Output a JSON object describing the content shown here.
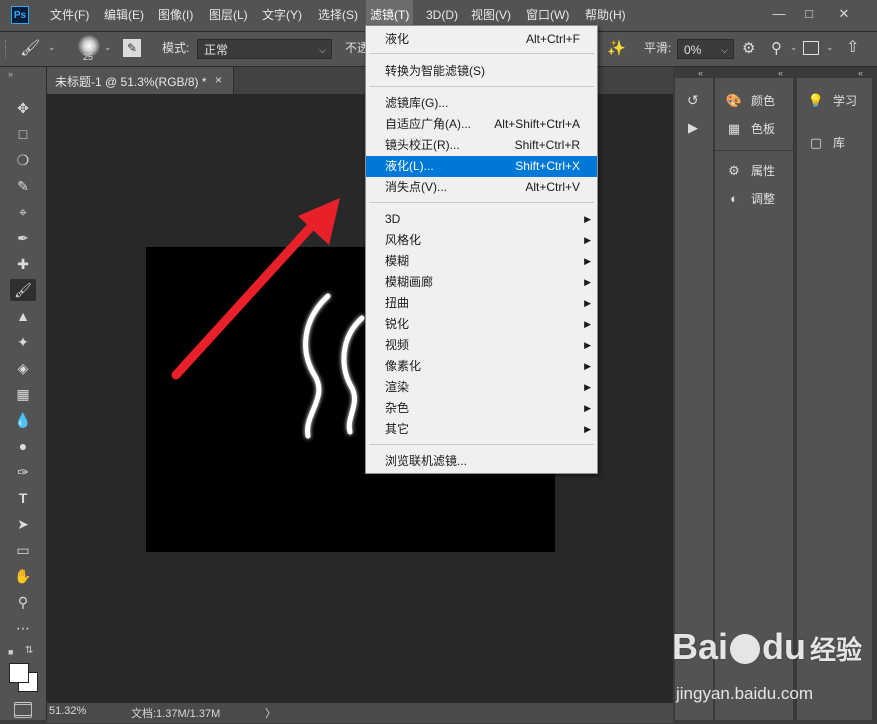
{
  "app": {
    "logo_text": "Ps"
  },
  "menubar": {
    "items": [
      "文件(F)",
      "编辑(E)",
      "图像(I)",
      "图层(L)",
      "文字(Y)",
      "选择(S)",
      "滤镜(T)",
      "3D(D)",
      "视图(V)",
      "窗口(W)",
      "帮助(H)"
    ],
    "active": "滤镜(T)",
    "window_controls": [
      "minimize-icon",
      "restore-icon",
      "close-icon"
    ]
  },
  "options_bar": {
    "brush_size": "25",
    "mode_label": "模式:",
    "mode_value": "正常",
    "opacity_label_partial": "不透",
    "smoothing_label": "平滑:",
    "smoothing_value": "0%"
  },
  "toolbar": {
    "tools": [
      "move-tool-icon",
      "marquee-tool-icon",
      "lasso-tool-icon",
      "quick-select-tool-icon",
      "crop-tool-icon",
      "eyedropper-tool-icon",
      "healing-brush-tool-icon",
      "brush-tool-icon",
      "clone-stamp-tool-icon",
      "history-brush-tool-icon",
      "eraser-tool-icon",
      "gradient-tool-icon",
      "blur-tool-icon",
      "dodge-tool-icon",
      "pen-tool-icon",
      "type-tool-icon",
      "path-select-tool-icon",
      "rectangle-tool-icon",
      "hand-tool-icon",
      "zoom-tool-icon",
      "more-tools-icon"
    ],
    "active_tool": "brush-tool-icon",
    "type_tool_glyph": "T",
    "foreground_color": "#ffffff",
    "background_color": "#ffffff"
  },
  "document": {
    "tab_title": "未标题-1 @ 51.3%(RGB/8) *",
    "tab_close": "×",
    "canvas_color": "#000000"
  },
  "status_bar": {
    "zoom": "51.32%",
    "doc_info": "文档:1.37M/1.37M",
    "arrow": "〉"
  },
  "filter_menu": {
    "items": [
      {
        "label": "液化",
        "shortcut": "Alt+Ctrl+F"
      },
      {
        "separator": true
      },
      {
        "label": "转换为智能滤镜(S)"
      },
      {
        "separator": true
      },
      {
        "label": "滤镜库(G)..."
      },
      {
        "label": "自适应广角(A)...",
        "shortcut": "Alt+Shift+Ctrl+A"
      },
      {
        "label": "镜头校正(R)...",
        "shortcut": "Shift+Ctrl+R"
      },
      {
        "label": "液化(L)...",
        "shortcut": "Shift+Ctrl+X",
        "highlighted": true
      },
      {
        "label": "消失点(V)...",
        "shortcut": "Alt+Ctrl+V"
      },
      {
        "separator": true
      },
      {
        "label": "3D",
        "submenu": true
      },
      {
        "label": "风格化",
        "submenu": true
      },
      {
        "label": "模糊",
        "submenu": true
      },
      {
        "label": "模糊画廊",
        "submenu": true
      },
      {
        "label": "扭曲",
        "submenu": true
      },
      {
        "label": "锐化",
        "submenu": true
      },
      {
        "label": "视频",
        "submenu": true
      },
      {
        "label": "像素化",
        "submenu": true
      },
      {
        "label": "渲染",
        "submenu": true
      },
      {
        "label": "杂色",
        "submenu": true
      },
      {
        "label": "其它",
        "submenu": true
      },
      {
        "separator": true
      },
      {
        "label": "浏览联机滤镜..."
      }
    ],
    "highlight_color": "#0078d7"
  },
  "right_panels": {
    "panel_a": [
      {
        "label": "颜色",
        "icon": "palette-icon"
      },
      {
        "label": "色板",
        "icon": "swatches-grid-icon"
      }
    ],
    "panel_b": [
      {
        "label": "属性",
        "icon": "properties-icon"
      },
      {
        "label": "调整",
        "icon": "adjustments-icon"
      }
    ],
    "panel_c": [
      {
        "label": "学习",
        "icon": "lightbulb-icon"
      },
      {
        "label": "库",
        "icon": "library-icon"
      }
    ],
    "collapsed_icons": [
      "history-icon",
      "play-icon"
    ]
  },
  "annotation": {
    "arrow_color": "#e8202a",
    "stroke_color": "#ffffff"
  },
  "watermark": {
    "logo_text": "Bai",
    "logo_text2": "du",
    "logo_cn": "经验",
    "url": "jingyan.baidu.com"
  }
}
